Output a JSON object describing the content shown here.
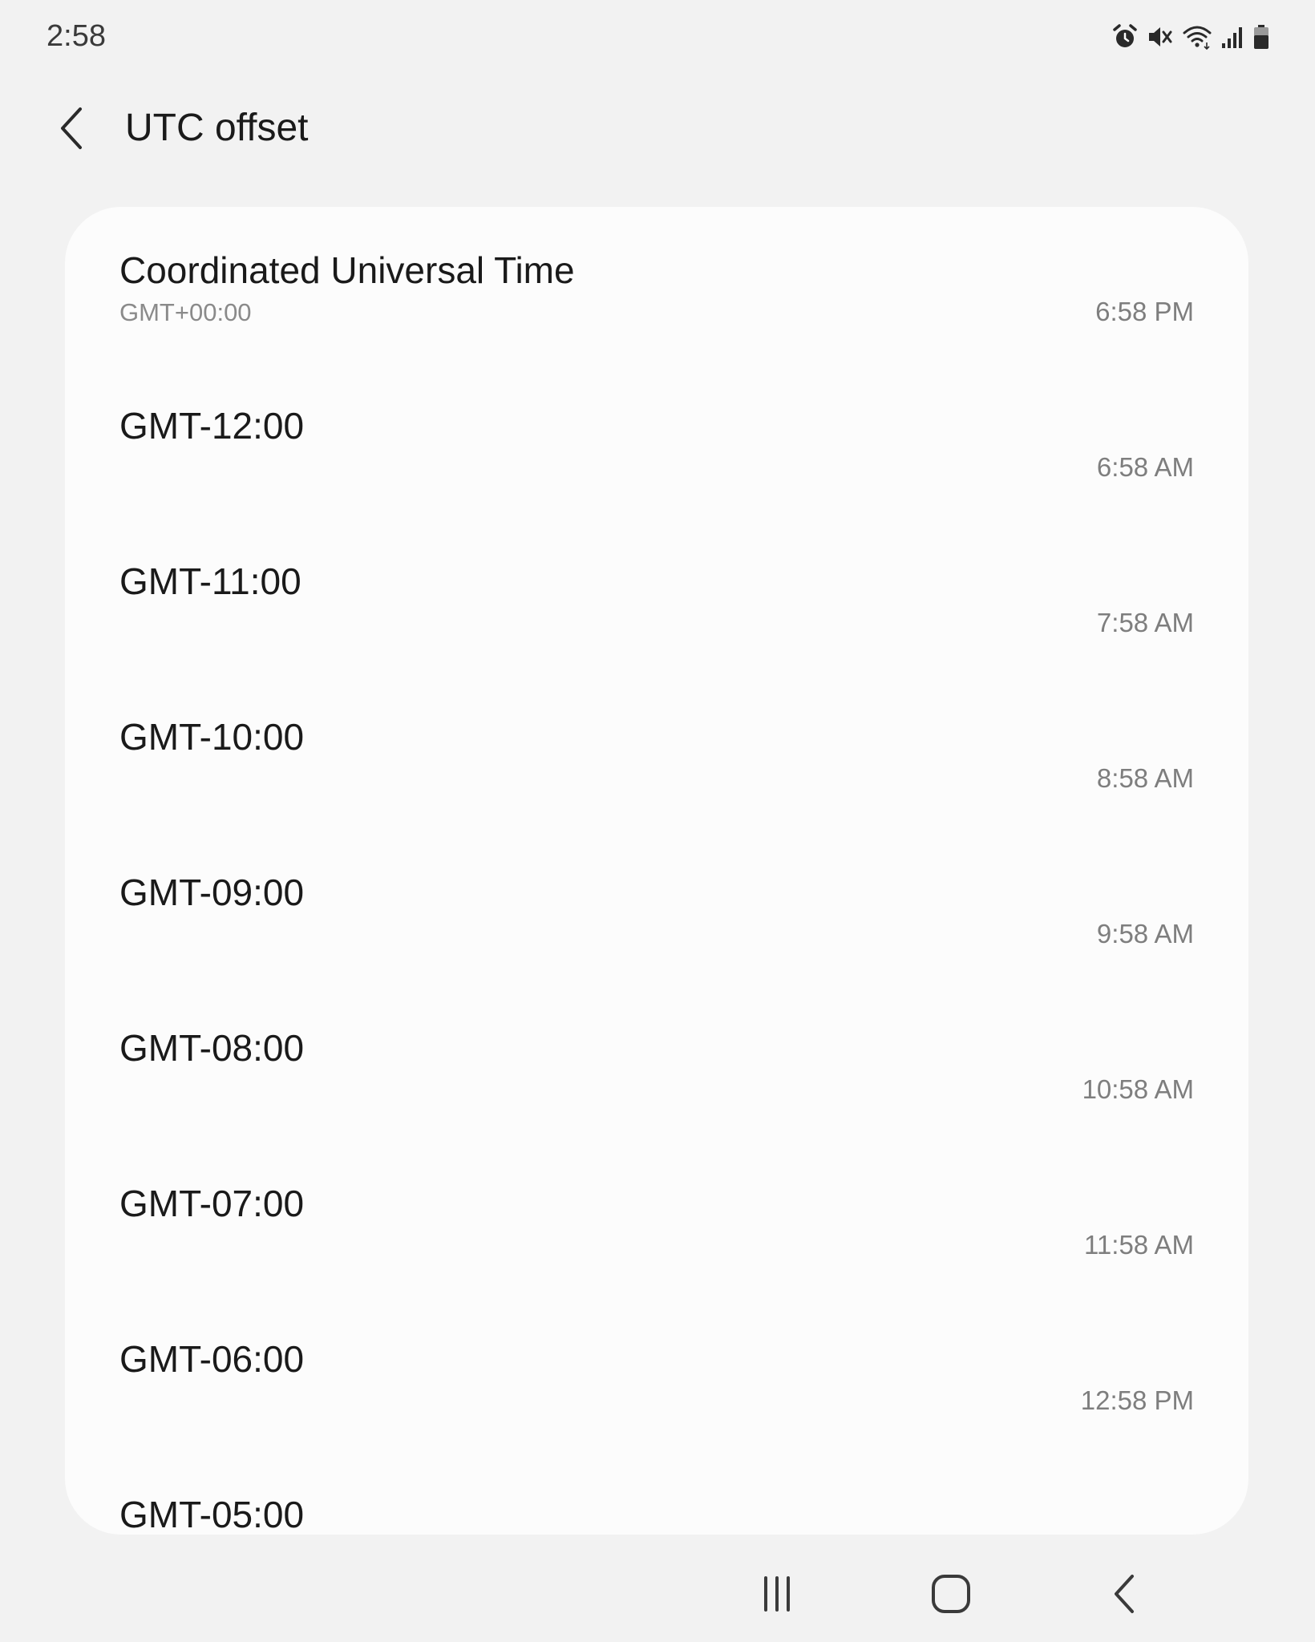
{
  "status_bar": {
    "time": "2:58",
    "icons": [
      "alarm-icon",
      "mute-icon",
      "wifi-icon",
      "signal-icon",
      "battery-icon"
    ]
  },
  "header": {
    "title": "UTC offset",
    "back_icon": "chevron-left-icon"
  },
  "list": {
    "items": [
      {
        "title": "Coordinated Universal Time",
        "subtitle": "GMT+00:00",
        "time": "6:58 PM"
      },
      {
        "title": "GMT-12:00",
        "time": "6:58 AM"
      },
      {
        "title": "GMT-11:00",
        "time": "7:58 AM"
      },
      {
        "title": "GMT-10:00",
        "time": "8:58 AM"
      },
      {
        "title": "GMT-09:00",
        "time": "9:58 AM"
      },
      {
        "title": "GMT-08:00",
        "time": "10:58 AM"
      },
      {
        "title": "GMT-07:00",
        "time": "11:58 AM"
      },
      {
        "title": "GMT-06:00",
        "time": "12:58 PM"
      },
      {
        "title": "GMT-05:00"
      }
    ]
  },
  "nav_bar": {
    "buttons": [
      "recents-icon",
      "home-icon",
      "back-icon"
    ]
  },
  "colors": {
    "background": "#f2f2f2",
    "card": "#fcfcfc",
    "primary_text": "#1a1a1a",
    "secondary_text": "#8a8a8a"
  }
}
